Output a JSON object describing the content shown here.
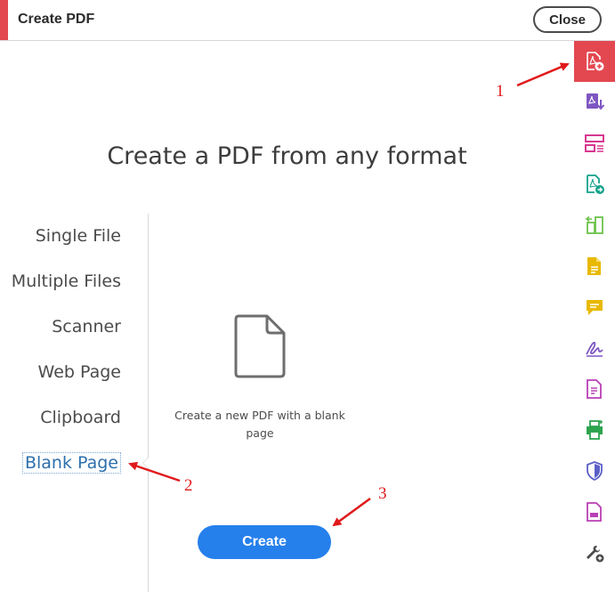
{
  "header": {
    "title": "Create PDF",
    "close_label": "Close"
  },
  "main": {
    "heading": "Create a PDF from any format",
    "menu": [
      "Single File",
      "Multiple Files",
      "Scanner",
      "Web Page",
      "Clipboard",
      "Blank Page"
    ],
    "selected": "Blank Page",
    "description": "Create a new PDF with a blank page",
    "create_label": "Create"
  },
  "tools": [
    {
      "icon": "create-pdf-icon",
      "color": "#ffffff",
      "active": true
    },
    {
      "icon": "export-pdf-icon",
      "color": "#7e56c2"
    },
    {
      "icon": "organize-pages-icon",
      "color": "#d83790"
    },
    {
      "icon": "send-pdf-icon",
      "color": "#12a28a"
    },
    {
      "icon": "compare-files-icon",
      "color": "#6cc24a"
    },
    {
      "icon": "edit-pdf-icon",
      "color": "#e8b900"
    },
    {
      "icon": "comment-icon",
      "color": "#e8b900"
    },
    {
      "icon": "fill-sign-icon",
      "color": "#7e56c2"
    },
    {
      "icon": "document-icon",
      "color": "#b93fb6"
    },
    {
      "icon": "print-production-icon",
      "color": "#2da44e"
    },
    {
      "icon": "protect-icon",
      "color": "#5b5fc7"
    },
    {
      "icon": "redact-icon",
      "color": "#b93fb6"
    },
    {
      "icon": "more-tools-icon",
      "color": "#4b4b4b"
    }
  ],
  "annotations": [
    "1",
    "2",
    "3"
  ],
  "colors": {
    "accent": "#e34850",
    "primary": "#2680eb",
    "annotation": "#e0191b"
  }
}
